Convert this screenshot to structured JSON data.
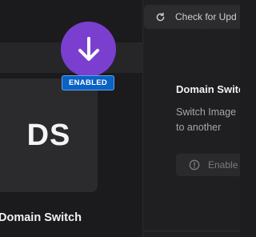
{
  "plugin": {
    "initials": "DS",
    "name": "Domain Switch",
    "status_badge": "ENABLED"
  },
  "header": {
    "update_label": "Check for Upd"
  },
  "details": {
    "title": "Domain Switc",
    "description_line1": "Switch Image",
    "description_line2": "to another",
    "enable_label": "Enable"
  },
  "colors": {
    "accent_purple": "#7b3fcf",
    "badge_blue": "#0a62c4"
  },
  "icons": {
    "download": "download-arrow-icon",
    "refresh": "refresh-icon",
    "info": "info-icon"
  }
}
